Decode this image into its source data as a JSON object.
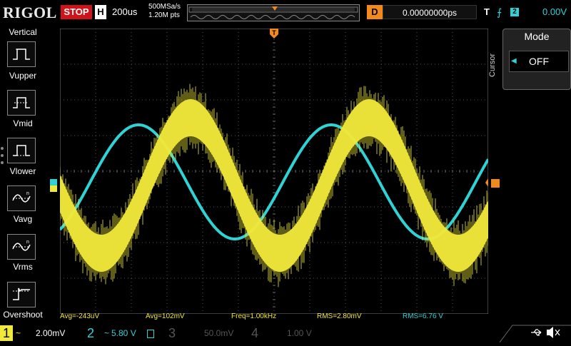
{
  "header": {
    "brand": "RIGOL",
    "run_state": "STOP",
    "timebase_label": "H",
    "timebase_value": "200us",
    "sample_rate": "500MSa/s",
    "memory_points": "1.20M pts",
    "delay_label": "D",
    "delay_value": "0.00000000ps",
    "trigger_label": "T",
    "trigger_source": "2",
    "trigger_level": "0.00V"
  },
  "left_menu": {
    "title": "Vertical",
    "items": [
      {
        "label": "Vupper"
      },
      {
        "label": "Vmid"
      },
      {
        "label": "Vlower"
      },
      {
        "label": "Vavg"
      },
      {
        "label": "Vrms"
      },
      {
        "label": "Overshoot"
      }
    ]
  },
  "right_menu": {
    "title": "Mode",
    "value": "OFF",
    "section_label": "Cursor"
  },
  "measurements": [
    {
      "text": "Avg=-243uV",
      "color": "#f0e83a"
    },
    {
      "text": "Avg=102mV",
      "color": "#f0e83a"
    },
    {
      "text": "Freq=1.00kHz",
      "color": "#f0e83a"
    },
    {
      "text": "RMS=2.80mV",
      "color": "#f0e83a"
    },
    {
      "text": "RMS=6.76 V",
      "color": "#2fd3d5"
    }
  ],
  "channels": [
    {
      "num": "1",
      "coupling": "~",
      "scale": "2.00mV",
      "color": "#f0e83a",
      "active": true
    },
    {
      "num": "2",
      "coupling": "~",
      "scale": "5.80 V",
      "color": "#2fd3d5",
      "active": true
    },
    {
      "num": "3",
      "coupling": "",
      "scale": "50.0mV",
      "color": "#b03aa8",
      "active": false
    },
    {
      "num": "4",
      "coupling": "",
      "scale": "1.00 V",
      "color": "#3a63d1",
      "active": false
    }
  ],
  "markers": {
    "ch1": "1",
    "ch2": "2",
    "trigger": "T"
  },
  "colors": {
    "ch1": "#f0e83a",
    "ch2": "#2fd3d5",
    "trigger": "#f2891c",
    "stop": "#d0121b"
  }
}
